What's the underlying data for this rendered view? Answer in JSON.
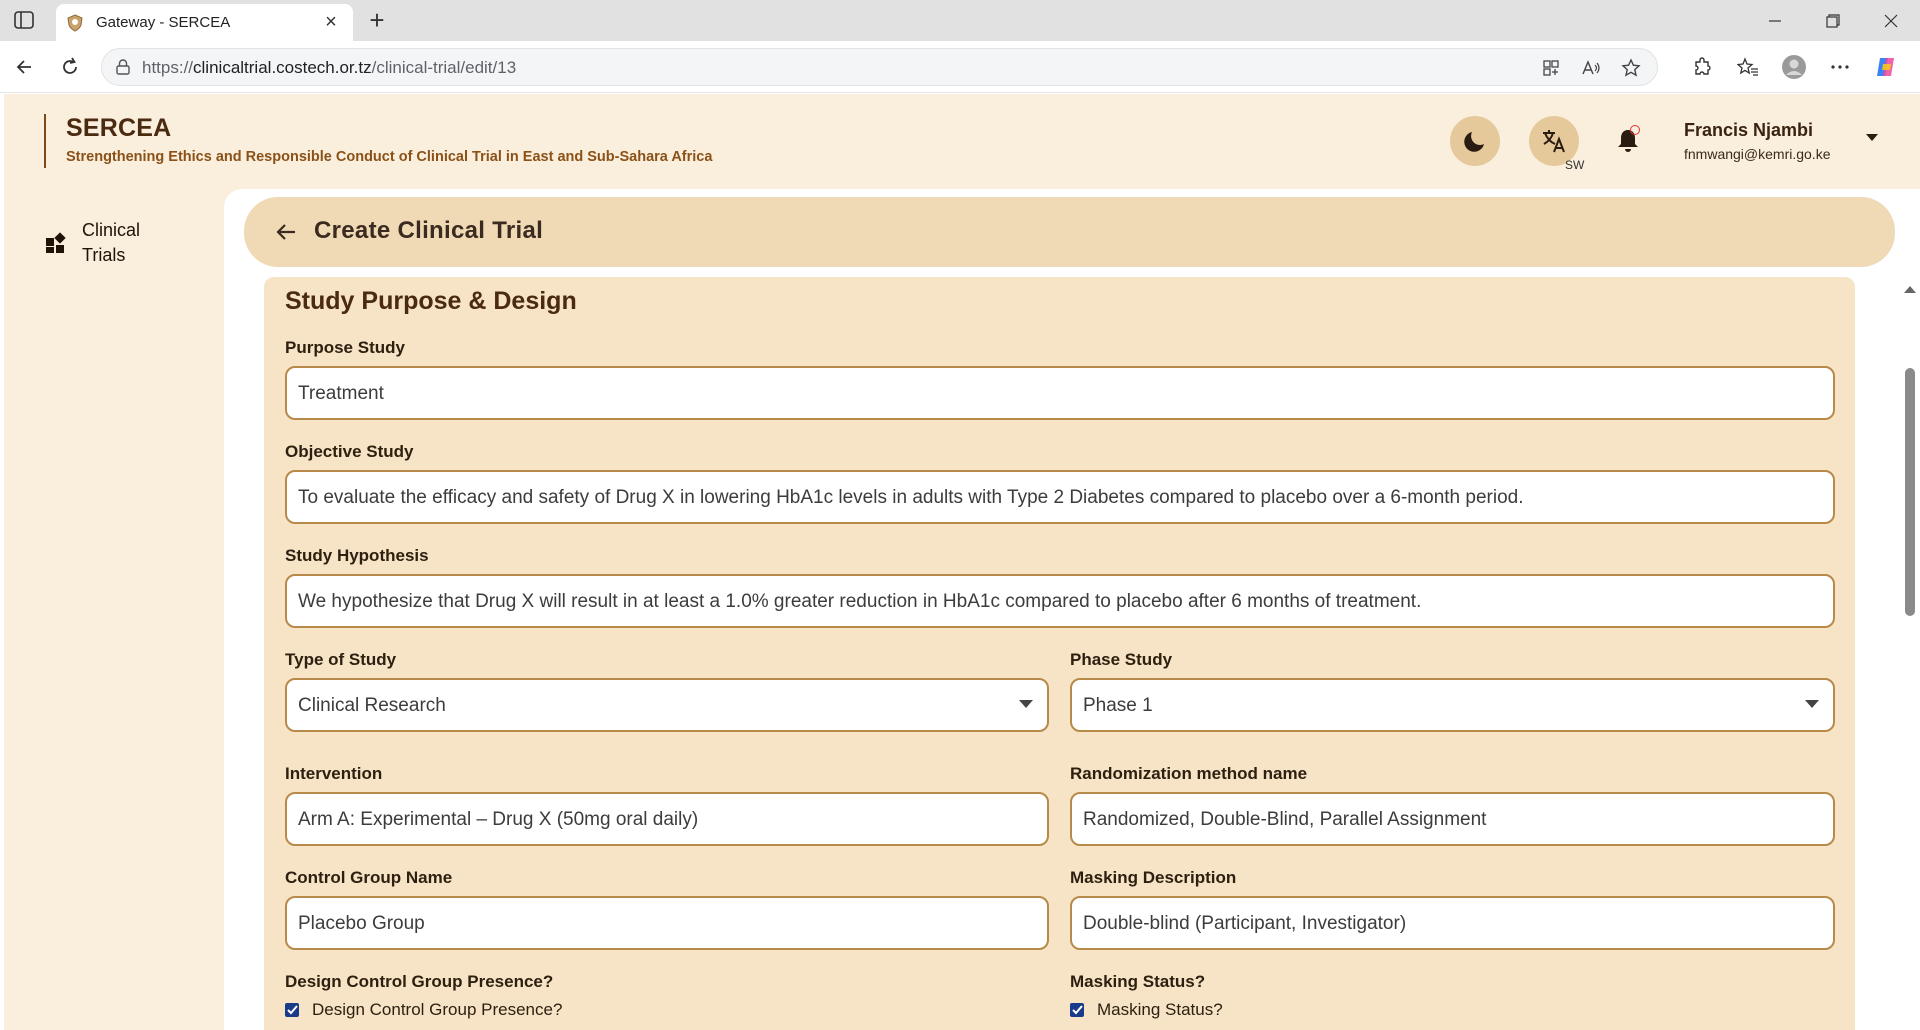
{
  "browser": {
    "tab_title": "Gateway - SERCEA",
    "url_prefix": "https://",
    "url_host": "clinicaltrial.costech.or.tz",
    "url_path": "/clinical-trial/edit/13"
  },
  "app": {
    "brand_title": "SERCEA",
    "brand_subtitle": "Strengthening Ethics and Responsible Conduct of Clinical Trial in East and Sub-Sahara Africa",
    "language_code": "SW",
    "user_name": "Francis Njambi",
    "user_email": "fnmwangi@kemri.go.ke"
  },
  "sidebar": {
    "items": [
      {
        "label": "Clinical Trials",
        "icon": "dashboard-icon"
      }
    ]
  },
  "page": {
    "header_title": "Create Clinical Trial",
    "section_title": "Study Purpose & Design"
  },
  "form": {
    "purpose_study": {
      "label": "Purpose Study",
      "value": "Treatment"
    },
    "objective_study": {
      "label": "Objective Study",
      "value": "To evaluate the efficacy and safety of Drug X in lowering HbA1c levels in adults with Type 2 Diabetes compared to placebo over a 6-month period."
    },
    "study_hypothesis": {
      "label": "Study Hypothesis",
      "value": "We hypothesize that Drug X will result in at least a 1.0% greater reduction in HbA1c compared to placebo after 6 months of treatment."
    },
    "type_of_study": {
      "label": "Type of Study",
      "value": "Clinical Research"
    },
    "phase_study": {
      "label": "Phase Study",
      "value": "Phase 1"
    },
    "intervention": {
      "label": "Intervention",
      "value": "Arm A: Experimental – Drug X (50mg oral daily)"
    },
    "randomization": {
      "label": "Randomization method name",
      "value": "Randomized, Double-Blind, Parallel Assignment"
    },
    "control_group_name": {
      "label": "Control Group Name",
      "value": "Placebo Group"
    },
    "masking_description": {
      "label": "Masking Description",
      "value": "Double-blind (Participant, Investigator)"
    },
    "design_control_presence": {
      "label": "Design Control Group Presence?",
      "checkbox_label": "Design Control Group Presence?",
      "checked": true
    },
    "masking_status": {
      "label": "Masking Status?",
      "checkbox_label": "Masking Status?",
      "checked": true
    }
  },
  "colors": {
    "app_background": "#faeedd",
    "header_bar": "#f0d9b5",
    "form_card": "#f7e4c6",
    "field_border": "#b88a4a",
    "brand_text": "#4a2a10",
    "checkbox": "#1a3a8a"
  }
}
